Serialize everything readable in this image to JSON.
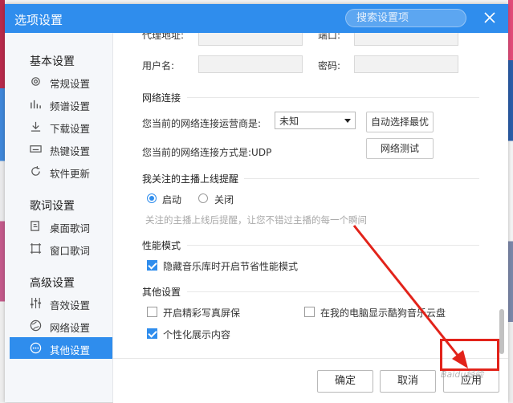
{
  "window": {
    "title": "选项设置",
    "search_placeholder": "搜索设置项"
  },
  "sidebar": {
    "sections": [
      {
        "title": "基本设置",
        "items": [
          "常规设置",
          "频谱设置",
          "下载设置",
          "热键设置",
          "软件更新"
        ]
      },
      {
        "title": "歌词设置",
        "items": [
          "桌面歌词",
          "窗口歌词"
        ]
      },
      {
        "title": "高级设置",
        "items": [
          "音效设置",
          "网络设置",
          "其他设置"
        ]
      }
    ],
    "active_item": "其他设置"
  },
  "proxy": {
    "address_label": "代理地址:",
    "port_label": "端口:",
    "username_label": "用户名:",
    "password_label": "密码:"
  },
  "network": {
    "group_title": "网络连接",
    "isp_label": "您当前的网络连接运营商是:",
    "isp_value": "未知",
    "auto_select_button": "自动选择最优",
    "mode_label": "您当前的网络连接方式是:UDP",
    "test_button": "网络测试"
  },
  "anchor_alert": {
    "group_title": "我关注的主播上线提醒",
    "option_on": "启动",
    "option_off": "关闭",
    "selected": "启动",
    "hint": "关注的主播上线后提醒，让您不错过主播的每一个瞬间"
  },
  "performance": {
    "group_title": "性能模式",
    "option": "隐藏音乐库时开启节省性能模式",
    "checked": true
  },
  "other": {
    "group_title": "其他设置",
    "screensaver": "开启精彩写真屏保",
    "screensaver_checked": false,
    "show_in_my_computer": "在我的电脑显示酷狗音乐云盘",
    "show_in_my_computer_checked": false,
    "personalize": "个性化展示内容",
    "personalize_checked": true
  },
  "footer": {
    "ok": "确定",
    "cancel": "取消",
    "apply": "应用"
  },
  "watermark": "Baidu经验",
  "colors": {
    "title_bar": "#2f8ded",
    "accent": "#2f8ded",
    "annotation_red": "#e2231a"
  }
}
